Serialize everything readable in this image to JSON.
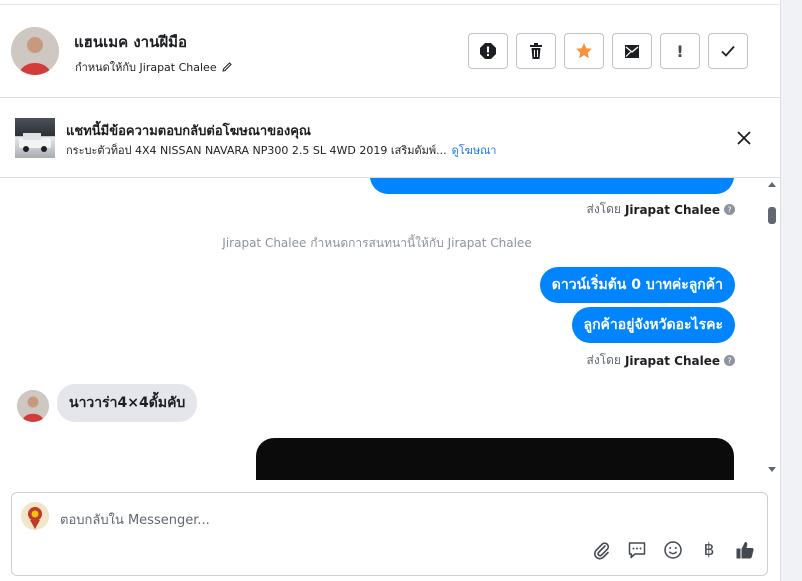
{
  "header": {
    "name": "แฮนเมค งานฝีมือ",
    "assign_text": "กำหนดให้กับ Jirapat Chalee",
    "actions": [
      "mark-spam",
      "delete",
      "star",
      "move-to-inbox",
      "mark-unread",
      "mark-done"
    ]
  },
  "ad": {
    "title": "แชทนี้มีข้อความตอบกลับต่อโฆษณาของคุณ",
    "subtitle": "กระบะตัวท็อป 4X4 NISSAN NAVARA NP300 2.5 SL 4WD 2019 เสริมดัมพ์...",
    "link": "ดูโฆษณา"
  },
  "chat": {
    "sent_by_label": "ส่งโดย",
    "sent_by_name": "Jirapat Chalee",
    "system_note": "Jirapat Chalee กำหนดการสนทนานี้ให้กับ Jirapat Chalee",
    "outgoing_1": "ดาวน์เริ่มต้น 0 บาทค่ะลูกค้า",
    "outgoing_2": "ลูกค้าอยู่จังหวัดอะไรคะ",
    "incoming_1": "นาวาร่า4×4ดั้มคับ"
  },
  "composer": {
    "placeholder": "ตอบกลับใน Messenger...",
    "tools": [
      "attach-icon",
      "saved-reply-icon",
      "emoji-icon",
      "payment-baht-icon",
      "like-icon"
    ]
  },
  "colors": {
    "accent": "#1877f2",
    "bubble_out": "#0084ff",
    "bubble_in": "#e4e6eb",
    "star": "#f7923a"
  }
}
